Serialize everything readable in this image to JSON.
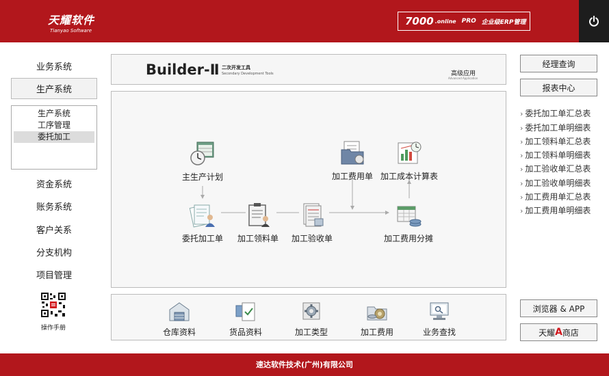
{
  "header": {
    "logo_cn": "天耀软件",
    "logo_en": "Tianyao Software",
    "badge_num": "7000",
    "badge_online": ".online",
    "badge_pro": "PRO",
    "badge_erp": "企业级ERP管理",
    "power_icon": "power-icon"
  },
  "left_nav": {
    "business": "业务系统",
    "production": "生产系统",
    "sub_items": [
      "生产系统",
      "工序管理",
      "委托加工"
    ],
    "funds": "资金系统",
    "accounts": "账务系统",
    "customers": "客户关系",
    "branches": "分支机构",
    "projects": "项目管理",
    "manual": "操作手册"
  },
  "banner": {
    "name": "Builder-Ⅱ",
    "sub_cn": "二次开发工具",
    "sub_en": "Secondary Development Tools",
    "adv_cn": "高级应用",
    "adv_en": "Advanced Application"
  },
  "workflow": {
    "master_plan": "主生产计划",
    "outsource_order": "委托加工单",
    "material_pick": "加工领料单",
    "inspection": "加工验收单",
    "fee_order": "加工费用单",
    "cost_sheet": "加工成本计算表",
    "fee_allocation": "加工费用分摊"
  },
  "toolbar": {
    "warehouse": "仓库资料",
    "goods": "货品资料",
    "process_type": "加工类型",
    "process_fee": "加工费用",
    "business_search": "业务查找"
  },
  "right": {
    "manager_query": "经理查询",
    "report_center": "报表中心",
    "links": [
      "委托加工单汇总表",
      "委托加工单明细表",
      "加工领料单汇总表",
      "加工领料单明细表",
      "加工验收单汇总表",
      "加工验收单明细表",
      "加工费用单汇总表",
      "加工费用单明细表"
    ],
    "chevron": "›",
    "browser_app": "浏览器 & APP",
    "shop_pre": "天耀",
    "shop_a": "A",
    "shop_post": "商店"
  },
  "footer": {
    "text": "速达软件技术(广州)有限公司"
  },
  "colors": {
    "brand_red": "#b2171c",
    "power_bg": "#1d1d1d"
  }
}
